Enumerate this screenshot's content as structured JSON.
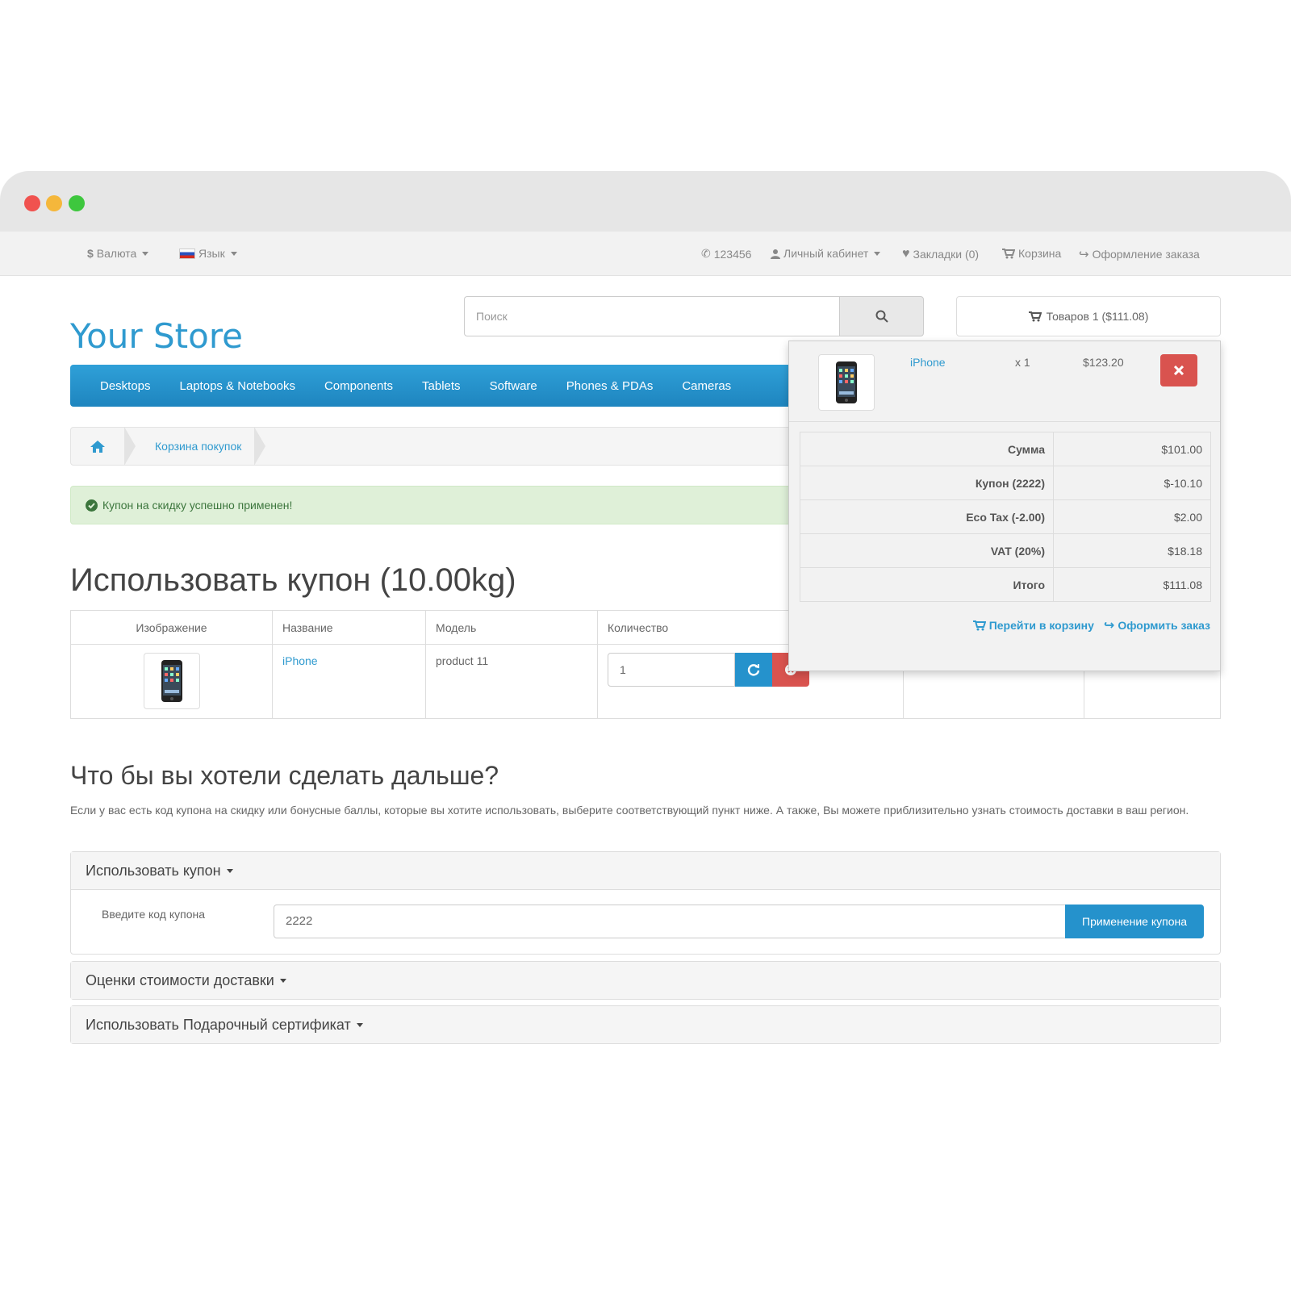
{
  "topbar": {
    "currency_label": "Валюта",
    "language_label": "Язык",
    "phone": "123456",
    "account_label": "Личный кабинет",
    "wishlist_label": "Закладки (0)",
    "cart_label": "Корзина",
    "checkout_label": "Оформление заказа"
  },
  "header": {
    "logo_text": "Your Store",
    "search_placeholder": "Поиск",
    "cart_button_label": "Товаров 1 ($111.08)"
  },
  "nav": {
    "items": [
      "Desktops",
      "Laptops & Notebooks",
      "Components",
      "Tablets",
      "Software",
      "Phones & PDAs",
      "Cameras"
    ]
  },
  "breadcrumb": {
    "current": "Корзина покупок"
  },
  "alert": {
    "text": "Купон на скидку успешно применен!"
  },
  "page": {
    "title": "Использовать купон  (10.00kg)"
  },
  "cart_table": {
    "headers": [
      "Изображение",
      "Название",
      "Модель",
      "Количество"
    ],
    "row": {
      "name": "iPhone",
      "model": "product 11",
      "quantity": "1"
    }
  },
  "next": {
    "title": "Что бы вы хотели сделать дальше?",
    "description": "Если у вас есть код купона на скидку или бонусные баллы, которые вы хотите использовать, выберите соответствующий пункт ниже. А также, Вы можете приблизительно узнать стоимость доставки в ваш регион."
  },
  "coupon_panel": {
    "title": "Использовать купон",
    "label": "Введите код купона",
    "value": "2222",
    "button": "Применение купона"
  },
  "shipping_panel": {
    "title": "Оценки стоимости доставки"
  },
  "voucher_panel": {
    "title": "Использовать Подарочный сертификат"
  },
  "dropdown": {
    "product_name": "iPhone",
    "product_qty": "x 1",
    "product_price": "$123.20",
    "totals": [
      {
        "label": "Сумма",
        "value": "$101.00"
      },
      {
        "label": "Купон (2222)",
        "value": "$-10.10"
      },
      {
        "label": "Eco Tax (-2.00)",
        "value": "$2.00"
      },
      {
        "label": "VAT (20%)",
        "value": "$18.18"
      },
      {
        "label": "Итого",
        "value": "$111.08"
      }
    ],
    "view_cart": "Перейти в корзину",
    "checkout": "Оформить заказ"
  },
  "colors": {
    "accent": "#2f9acf",
    "nav_bg": "#2592cc",
    "danger": "#d9534f",
    "success_bg": "#dff0d8"
  }
}
